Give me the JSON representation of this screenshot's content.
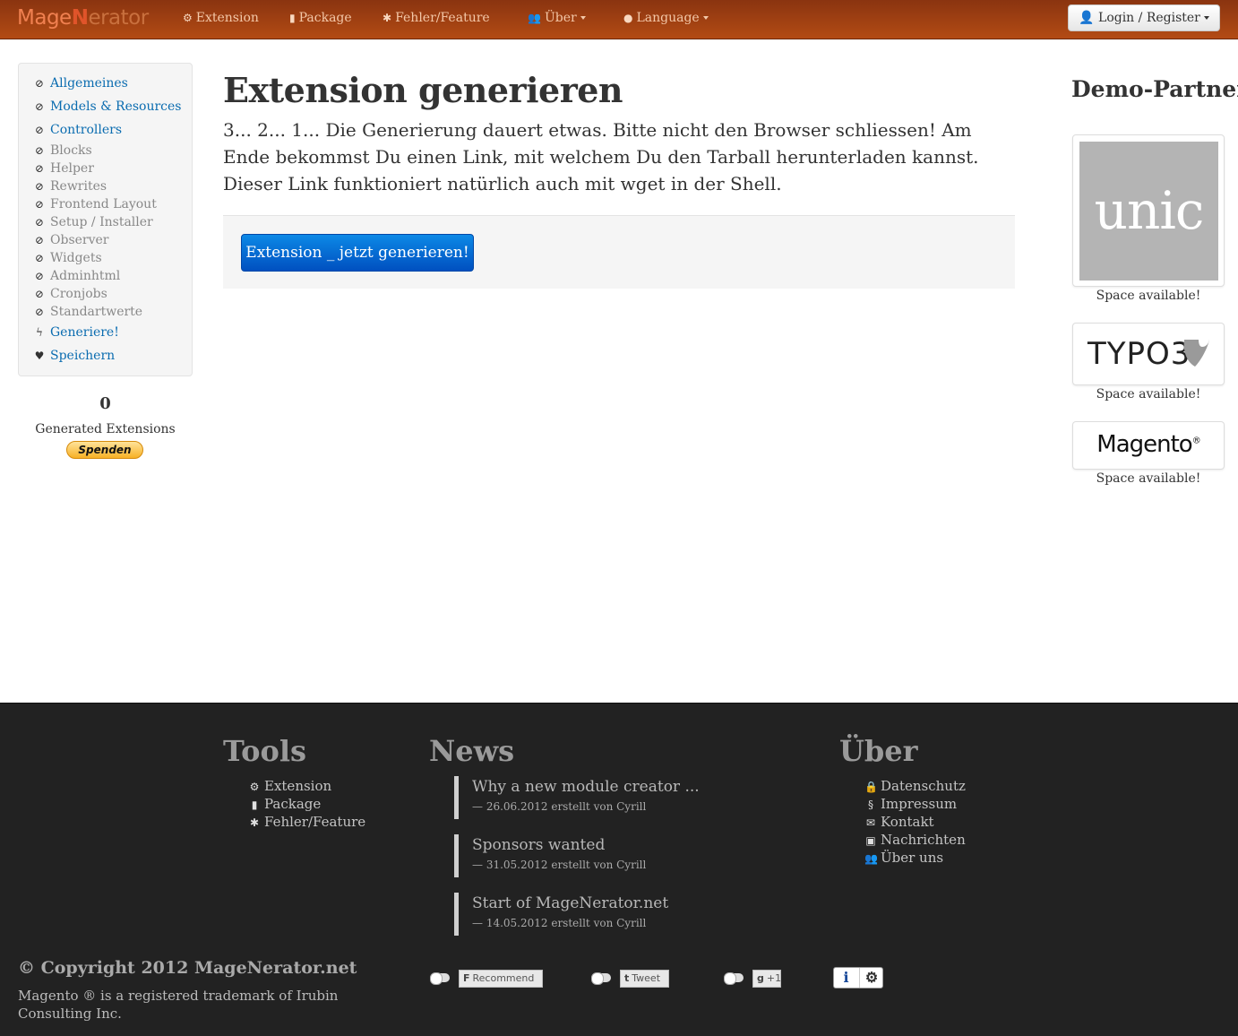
{
  "navbar": {
    "logo_part1": "Mage",
    "logo_part2": "N",
    "logo_part3": "erator",
    "items": [
      {
        "label": "Extension",
        "icon": "gears-icon"
      },
      {
        "label": "Package",
        "icon": "book-icon"
      },
      {
        "label": "Fehler/Feature",
        "icon": "bug-icon"
      },
      {
        "label": "Über",
        "icon": "users-icon"
      },
      {
        "label": "Language",
        "icon": "globe-icon"
      }
    ],
    "login_label": "Login / Register"
  },
  "sidebar": {
    "items": [
      {
        "label": "Allgemeines",
        "icon": "check-circle-icon"
      },
      {
        "label": "Models & Resources",
        "icon": "check-circle-icon"
      },
      {
        "label": "Controllers",
        "icon": "check-circle-icon"
      },
      {
        "label": "Blocks",
        "icon": "ban-circle-icon"
      },
      {
        "label": "Helper",
        "icon": "ban-circle-icon"
      },
      {
        "label": "Rewrites",
        "icon": "ban-circle-icon"
      },
      {
        "label": "Frontend Layout",
        "icon": "ban-circle-icon"
      },
      {
        "label": "Setup / Installer",
        "icon": "ban-circle-icon"
      },
      {
        "label": "Observer",
        "icon": "ban-circle-icon"
      },
      {
        "label": "Widgets",
        "icon": "ban-circle-icon"
      },
      {
        "label": "Adminhtml",
        "icon": "ban-circle-icon"
      },
      {
        "label": "Cronjobs",
        "icon": "ban-circle-icon"
      },
      {
        "label": "Standartwerte",
        "icon": "ban-circle-icon"
      },
      {
        "label": "Generiere!",
        "icon": "lightning-icon"
      },
      {
        "label": "Speichern",
        "icon": "heart-icon"
      }
    ],
    "counter_value": "0",
    "counter_caption": "Generated Extensions",
    "donate_label": "Spenden"
  },
  "main": {
    "title": "Extension generieren",
    "description": "3... 2... 1... Die Generierung dauert etwas. Bitte nicht den Browser schliessen! Am Ende bekommst Du einen Link, mit welchem Du den Tarball herunterladen kannst. Dieser Link funktioniert natürlich auch mit wget in der Shell.",
    "button_label": "Extension _ jetzt generieren!"
  },
  "partners": {
    "title": "Demo-Partner",
    "items": [
      {
        "logo_text": "unic",
        "caption": "Space available!"
      },
      {
        "logo_text": "TYPO3",
        "caption": "Space available!"
      },
      {
        "logo_text": "Magento",
        "logo_sup": "®",
        "caption": "Space available!"
      }
    ]
  },
  "footer": {
    "tools": {
      "heading": "Tools",
      "links": [
        {
          "label": "Extension",
          "icon": "gears-icon"
        },
        {
          "label": "Package",
          "icon": "book-icon"
        },
        {
          "label": "Fehler/Feature",
          "icon": "bug-icon"
        }
      ]
    },
    "news": {
      "heading": "News",
      "items": [
        {
          "title": "Why a new module creator ...",
          "meta": "— 26.06.2012 erstellt von Cyrill"
        },
        {
          "title": "Sponsors wanted",
          "meta": "— 31.05.2012 erstellt von Cyrill"
        },
        {
          "title": "Start of MageNerator.net",
          "meta": "— 14.05.2012 erstellt von Cyrill"
        }
      ]
    },
    "about": {
      "heading": "Über",
      "links": [
        {
          "label": "Datenschutz",
          "icon": "lock-icon"
        },
        {
          "label": "Impressum",
          "icon": "paragraph-icon"
        },
        {
          "label": "Kontakt",
          "icon": "envelope-icon"
        },
        {
          "label": "Nachrichten",
          "icon": "inbox-icon"
        },
        {
          "label": "Über uns",
          "icon": "users-icon"
        }
      ]
    },
    "copyright": "© Copyright 2012 MageNerator.net",
    "trademark": "Magento ® is a registered trademark of Irubin Consulting Inc.",
    "social": {
      "facebook_label": "Recommend",
      "twitter_label": "Tweet",
      "gplus_label": "+1",
      "info_label": "i",
      "settings_label": "⚙"
    }
  }
}
